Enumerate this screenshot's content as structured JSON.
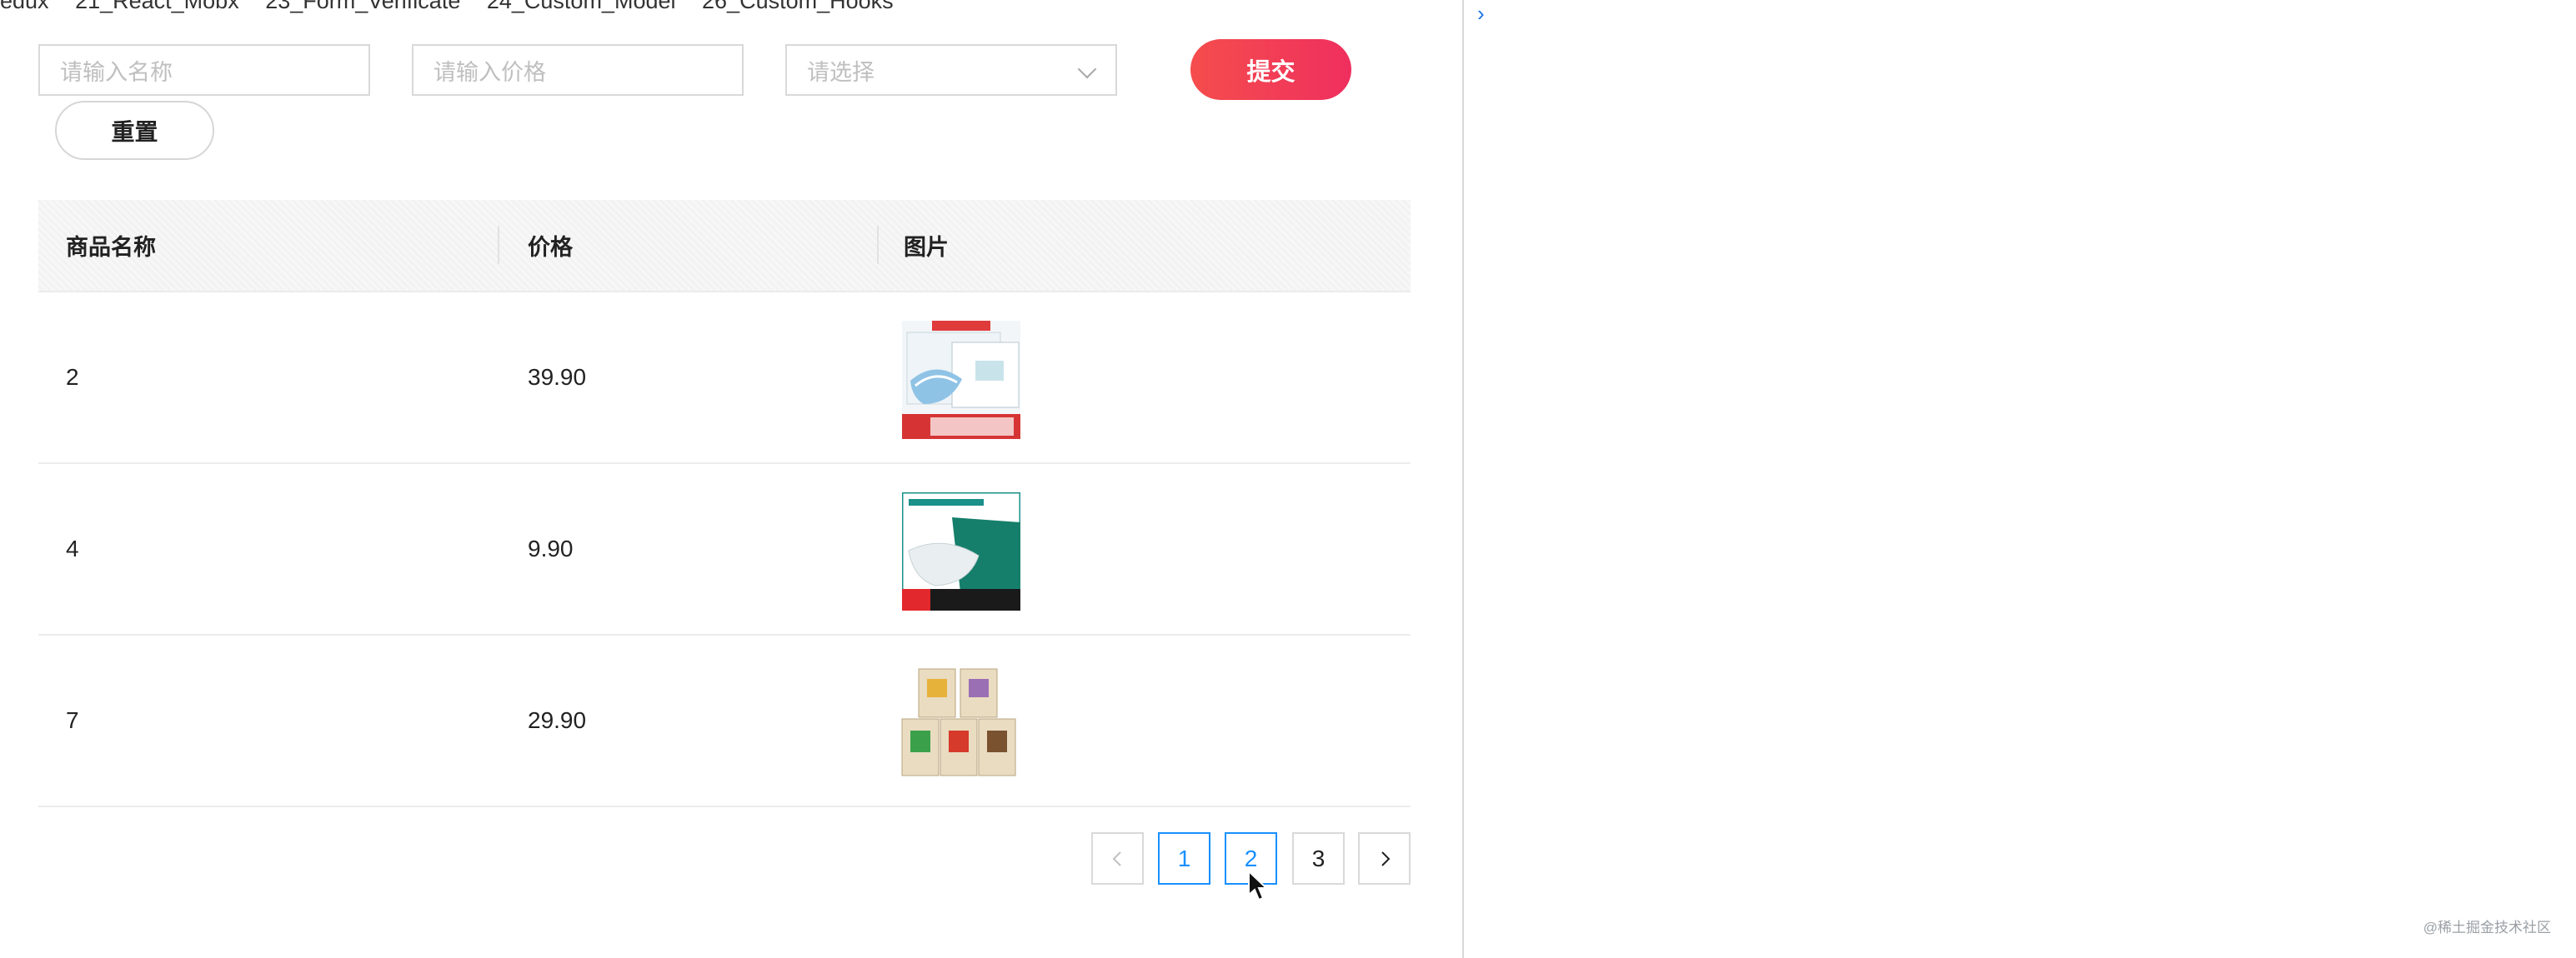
{
  "breadcrumb": [
    "edux",
    "21_React_Mobx",
    "23_Form_Verificate",
    "24_Custom_Model",
    "26_Custom_Hooks"
  ],
  "form": {
    "name_placeholder": "请输入名称",
    "price_placeholder": "请输入价格",
    "select_placeholder": "请选择",
    "submit_label": "提交",
    "reset_label": "重置"
  },
  "table": {
    "columns": [
      "商品名称",
      "价格",
      "图片"
    ],
    "rows": [
      {
        "name": "2",
        "price": "39.90",
        "image": "mask-pack-blue"
      },
      {
        "name": "4",
        "price": "9.90",
        "image": "mask-pack-green"
      },
      {
        "name": "7",
        "price": "29.90",
        "image": "food-bags"
      }
    ]
  },
  "pagination": {
    "prev_icon": "chevron-left-icon",
    "pages": [
      "1",
      "2",
      "3"
    ],
    "active_page": "2",
    "next_icon": "chevron-right-icon"
  },
  "console": {
    "prompt_icon": "chevron-right-icon"
  },
  "watermark": "@稀土掘金技术社区",
  "colors": {
    "accent": "#f2384f",
    "link": "#1890ff",
    "border": "#d9d9d9"
  }
}
